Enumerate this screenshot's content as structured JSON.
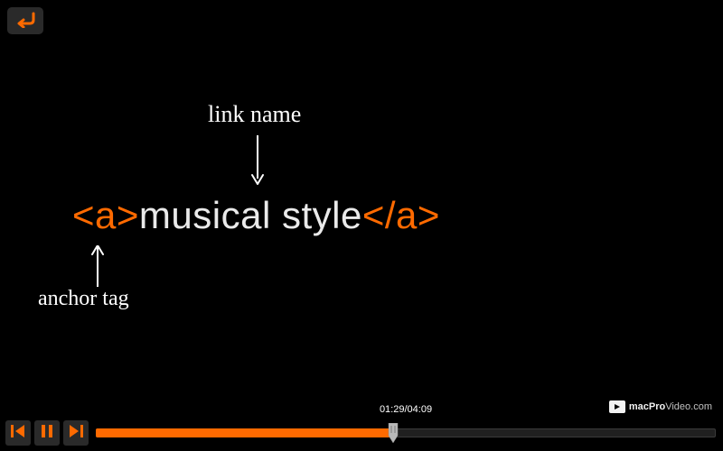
{
  "colors": {
    "accent": "#ff6a00",
    "bg": "#000000",
    "text": "#eaeaea"
  },
  "back_button": {
    "name": "back"
  },
  "slide": {
    "label_link_name": "link name",
    "label_anchor_tag": "anchor tag",
    "code": {
      "open_tag": "<a>",
      "link_text": "musical style",
      "close_tag": "</a>"
    }
  },
  "watermark": {
    "brand_bold": "macPro",
    "brand_light": "Video.com"
  },
  "player": {
    "time_current": "01:29",
    "time_total": "04:09",
    "time_sep": "/",
    "progress_percent": 48,
    "controls": {
      "prev": "previous",
      "pause": "pause",
      "next": "next"
    }
  }
}
